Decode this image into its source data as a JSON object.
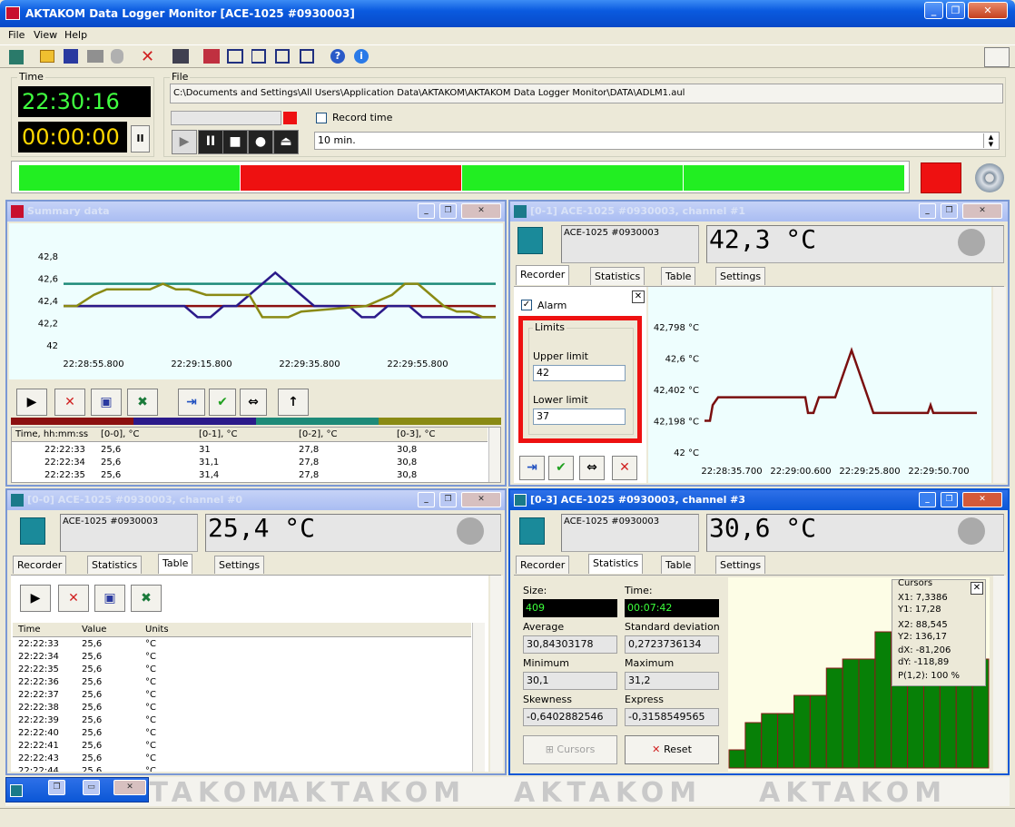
{
  "app": {
    "title": "AKTAKOM Data Logger Monitor [ACE-1025 #0930003]"
  },
  "menu": [
    "File",
    "View",
    "Help"
  ],
  "time": {
    "label": "Time",
    "clock": "22:30:16",
    "elapsed": "00:00:00",
    "pause": "II"
  },
  "file": {
    "label": "File",
    "path": "C:\\Documents and Settings\\All Users\\Application Data\\AKTAKOM\\AKTAKOM Data Logger Monitor\\DATA\\ADLM1.aul",
    "record_time_label": "Record time",
    "record_duration": "10 min."
  },
  "status_bar_colors": [
    "#22ee22",
    "#ee1111",
    "#22ee22",
    "#22ee22"
  ],
  "summary": {
    "title": "Summary data",
    "chart_data": {
      "type": "line",
      "yticks": [
        "42,8",
        "42,6",
        "42,4",
        "42,2",
        "42"
      ],
      "xticks": [
        "22:28:55.800",
        "22:29:15.800",
        "22:29:35.800",
        "22:29:55.800"
      ],
      "ylim": [
        42,
        42.8
      ],
      "series": [
        {
          "color": "#1e8a78",
          "x": [
            0,
            1
          ],
          "y": [
            42.55,
            42.55
          ]
        },
        {
          "color": "#8b1010",
          "x": [
            0,
            1
          ],
          "y": [
            42.35,
            42.35
          ]
        },
        {
          "color": "#2b1a8a",
          "x": [
            0,
            0.28,
            0.31,
            0.34,
            0.37,
            0.4,
            0.43,
            0.46,
            0.49,
            0.52,
            0.55,
            0.58,
            0.61,
            0.66,
            0.69,
            0.72,
            0.75,
            0.8,
            0.83,
            0.86,
            0.9,
            0.93,
            0.96,
            1
          ],
          "y": [
            42.35,
            42.35,
            42.25,
            42.25,
            42.35,
            42.35,
            42.45,
            42.55,
            42.65,
            42.55,
            42.45,
            42.35,
            42.35,
            42.35,
            42.25,
            42.25,
            42.35,
            42.35,
            42.25,
            42.25,
            42.25,
            42.25,
            42.25,
            42.25
          ]
        },
        {
          "color": "#8a8a14",
          "x": [
            0,
            0.03,
            0.07,
            0.1,
            0.17,
            0.2,
            0.23,
            0.26,
            0.29,
            0.33,
            0.43,
            0.46,
            0.49,
            0.52,
            0.55,
            0.7,
            0.73,
            0.76,
            0.79,
            0.82,
            0.85,
            0.88,
            0.91,
            0.94,
            0.97,
            1
          ],
          "y": [
            42.35,
            42.35,
            42.45,
            42.5,
            42.5,
            42.5,
            42.55,
            42.5,
            42.5,
            42.45,
            42.45,
            42.25,
            42.25,
            42.25,
            42.3,
            42.35,
            42.4,
            42.45,
            42.55,
            42.55,
            42.45,
            42.35,
            42.3,
            42.3,
            42.25,
            42.25
          ]
        }
      ]
    },
    "columns": [
      "Time, hh:mm:ss",
      "[0-0], °C",
      "[0-1], °C",
      "[0-2], °C",
      "[0-3], °C"
    ],
    "rows": [
      [
        "22:22:33",
        "25,6",
        "31",
        "27,8",
        "30,8"
      ],
      [
        "22:22:34",
        "25,6",
        "31,1",
        "27,8",
        "30,8"
      ],
      [
        "22:22:35",
        "25,6",
        "31,4",
        "27,8",
        "30,8"
      ]
    ]
  },
  "ch1": {
    "title": "[0-1] ACE-1025 #0930003, channel #1",
    "device": "ACE-1025 #0930003",
    "temp": "42,3 °C",
    "tabs": [
      "Recorder",
      "Statistics",
      "Table",
      "Settings"
    ],
    "alarm_label": "Alarm",
    "limits_label": "Limits",
    "upper_label": "Upper limit",
    "upper_value": "42",
    "lower_label": "Lower limit",
    "lower_value": "37",
    "chart_data": {
      "type": "line",
      "yticks": [
        "42,798 °C",
        "42,6 °C",
        "42,402 °C",
        "42,198 °C",
        "42 °C"
      ],
      "xticks": [
        "22:28:35.700",
        "22:29:00.600",
        "22:29:25.800",
        "22:29:50.700"
      ],
      "ylim": [
        42,
        42.8
      ],
      "series": [
        {
          "color": "#7a0f0f",
          "x": [
            0,
            0.02,
            0.03,
            0.05,
            0.37,
            0.38,
            0.4,
            0.42,
            0.43,
            0.48,
            0.5,
            0.52,
            0.54,
            0.56,
            0.58,
            0.6,
            0.62,
            0.64,
            0.66,
            0.68,
            0.7,
            0.72,
            0.82,
            0.83,
            0.84,
            0.85,
            1
          ],
          "y": [
            42.2,
            42.2,
            42.3,
            42.35,
            42.35,
            42.25,
            42.25,
            42.35,
            42.35,
            42.35,
            42.45,
            42.55,
            42.65,
            42.55,
            42.45,
            42.35,
            42.25,
            42.25,
            42.25,
            42.25,
            42.25,
            42.25,
            42.25,
            42.3,
            42.25,
            42.25,
            42.25
          ]
        }
      ]
    }
  },
  "ch0": {
    "title": "[0-0] ACE-1025 #0930003, channel #0",
    "device": "ACE-1025 #0930003",
    "temp": "25,4 °C",
    "tabs": [
      "Recorder",
      "Statistics",
      "Table",
      "Settings"
    ],
    "columns": [
      "Time",
      "Value",
      "Units"
    ],
    "rows": [
      [
        "22:22:33",
        "25,6",
        "°C"
      ],
      [
        "22:22:34",
        "25,6",
        "°C"
      ],
      [
        "22:22:35",
        "25,6",
        "°C"
      ],
      [
        "22:22:36",
        "25,6",
        "°C"
      ],
      [
        "22:22:37",
        "25,6",
        "°C"
      ],
      [
        "22:22:38",
        "25,6",
        "°C"
      ],
      [
        "22:22:39",
        "25,6",
        "°C"
      ],
      [
        "22:22:40",
        "25,6",
        "°C"
      ],
      [
        "22:22:41",
        "25,6",
        "°C"
      ],
      [
        "22:22:43",
        "25,6",
        "°C"
      ],
      [
        "22:22:44",
        "25,6",
        "°C"
      ]
    ]
  },
  "ch3": {
    "title": "[0-3] ACE-1025 #0930003, channel #3",
    "device": "ACE-1025 #0930003",
    "temp": "30,6 °C",
    "tabs": [
      "Recorder",
      "Statistics",
      "Table",
      "Settings"
    ],
    "stats": {
      "size_label": "Size:",
      "size": "409",
      "time_label": "Time:",
      "time": "00:07:42",
      "average_label": "Average",
      "average": "30,84303178",
      "std_label": "Standard deviation",
      "std": "0,2723736134",
      "min_label": "Minimum",
      "min": "30,1",
      "max_label": "Maximum",
      "max": "31,2",
      "skew_label": "Skewness",
      "skew": "-0,6402882546",
      "express_label": "Express",
      "express": "-0,3158549565",
      "cursors_btn": "Cursors",
      "reset_btn": "Reset"
    },
    "cursors": {
      "title": "Cursors",
      "x1": "X1: 7,3386",
      "y1": "Y1: 17,28",
      "x2": "X2: 88,545",
      "y2": "Y2: 136,17",
      "dx": "dX: -81,206",
      "dy": "dY: -118,89",
      "p": "P(1,2): 100 %"
    },
    "histogram": {
      "type": "bar",
      "values": [
        2,
        5,
        6,
        6,
        8,
        8,
        11,
        12,
        12,
        15,
        15,
        16,
        13,
        13,
        13,
        12
      ]
    }
  },
  "watermark": "AKTAKOM"
}
